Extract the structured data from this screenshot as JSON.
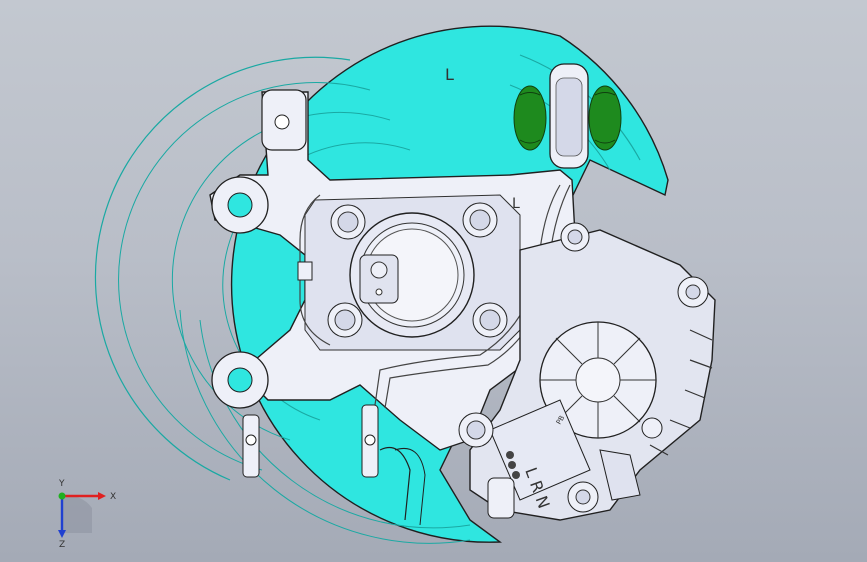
{
  "viewport": {
    "background": "#b9bec8",
    "model": "rear knuckle assembly with brake dust shield, caliper and bushing"
  },
  "colors": {
    "shield": "#2fe6e0",
    "shield_dark": "#19c2bb",
    "knuckle": "#eef0f8",
    "knuckle_shade": "#d4d8e8",
    "bushing": "#2a9a2a",
    "edge": "#202020"
  },
  "stamps": {
    "shield_mark": "L",
    "knuckle_mark": "L",
    "caliper_text": "L R N",
    "caliper_small": "PB"
  },
  "triad": {
    "x_label": "X",
    "y_label": "Y",
    "z_label": "Z",
    "x_color": "#e02020",
    "y_color": "#20b020",
    "z_color": "#2040d0"
  }
}
